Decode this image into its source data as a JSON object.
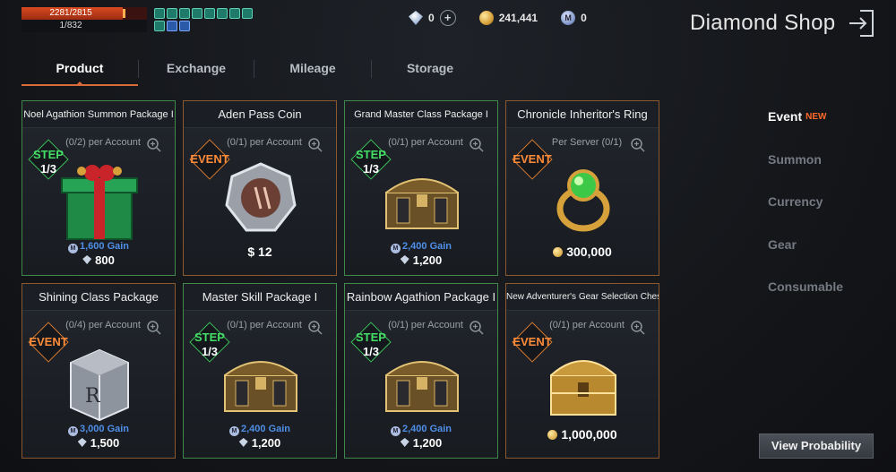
{
  "hud": {
    "hp_text": "2281/2815",
    "hp_fraction": 0.81,
    "level_text": "1/832",
    "buffs": [
      "buff",
      "buff",
      "buff",
      "buff",
      "buff",
      "buff",
      "buff",
      "buff",
      "buff"
    ]
  },
  "currencies": {
    "diamond": "0",
    "gold": "241,441",
    "mileage": "0",
    "mileage_symbol": "M",
    "plus_glyph": "+"
  },
  "header": {
    "title": "Diamond Shop"
  },
  "tabs": [
    {
      "label": "Product",
      "active": true
    },
    {
      "label": "Exchange",
      "active": false
    },
    {
      "label": "Mileage",
      "active": false
    },
    {
      "label": "Storage",
      "active": false
    }
  ],
  "products": [
    {
      "title": "Noel Agathion Summon Package I",
      "limit": "(0/2) per Account",
      "badge": "STEP",
      "badge_sub": "1/3",
      "gain": "1,600",
      "gain_suffix": "Gain",
      "price": "800",
      "art": "gift-box-icon"
    },
    {
      "title": "Aden Pass Coin",
      "limit": "(0/1) per Account",
      "badge": "EVENT",
      "badge_sub": "",
      "gain": "",
      "gain_suffix": "",
      "price": "$ 12",
      "art": "coin-icon"
    },
    {
      "title": "Grand Master Class Package I",
      "limit": "(0/1) per Account",
      "badge": "STEP",
      "badge_sub": "1/3",
      "gain": "2,400",
      "gain_suffix": "Gain",
      "price": "1,200",
      "art": "chest-icon"
    },
    {
      "title": "Chronicle Inheritor's Ring",
      "limit": "Per Server (0/1)",
      "badge": "EVENT",
      "badge_sub": "",
      "gain": "",
      "gain_suffix": "",
      "price": "300,000",
      "art": "ring-icon"
    },
    {
      "title": "Shining Class Package",
      "limit": "(0/4) per Account",
      "badge": "EVENT",
      "badge_sub": "",
      "gain": "3,000",
      "gain_suffix": "Gain",
      "price": "1,500",
      "art": "silver-box-icon"
    },
    {
      "title": "Master Skill Package I",
      "limit": "(0/1) per Account",
      "badge": "STEP",
      "badge_sub": "1/3",
      "gain": "2,400",
      "gain_suffix": "Gain",
      "price": "1,200",
      "art": "chest-icon"
    },
    {
      "title": "Rainbow Agathion Package I",
      "limit": "(0/1) per Account",
      "badge": "STEP",
      "badge_sub": "1/3",
      "gain": "2,400",
      "gain_suffix": "Gain",
      "price": "1,200",
      "art": "chest-icon"
    },
    {
      "title": "New Adventurer's Gear Selection Chest",
      "limit": "(0/1) per Account",
      "badge": "EVENT",
      "badge_sub": "",
      "gain": "",
      "gain_suffix": "",
      "price": "1,000,000",
      "art": "gold-chest-icon"
    }
  ],
  "categories": [
    {
      "label": "Event",
      "new": "NEW",
      "active": true
    },
    {
      "label": "Summon",
      "new": "",
      "active": false
    },
    {
      "label": "Currency",
      "new": "",
      "active": false
    },
    {
      "label": "Gear",
      "new": "",
      "active": false
    },
    {
      "label": "Consumable",
      "new": "",
      "active": false
    }
  ],
  "footer": {
    "view_probability": "View Probability"
  }
}
